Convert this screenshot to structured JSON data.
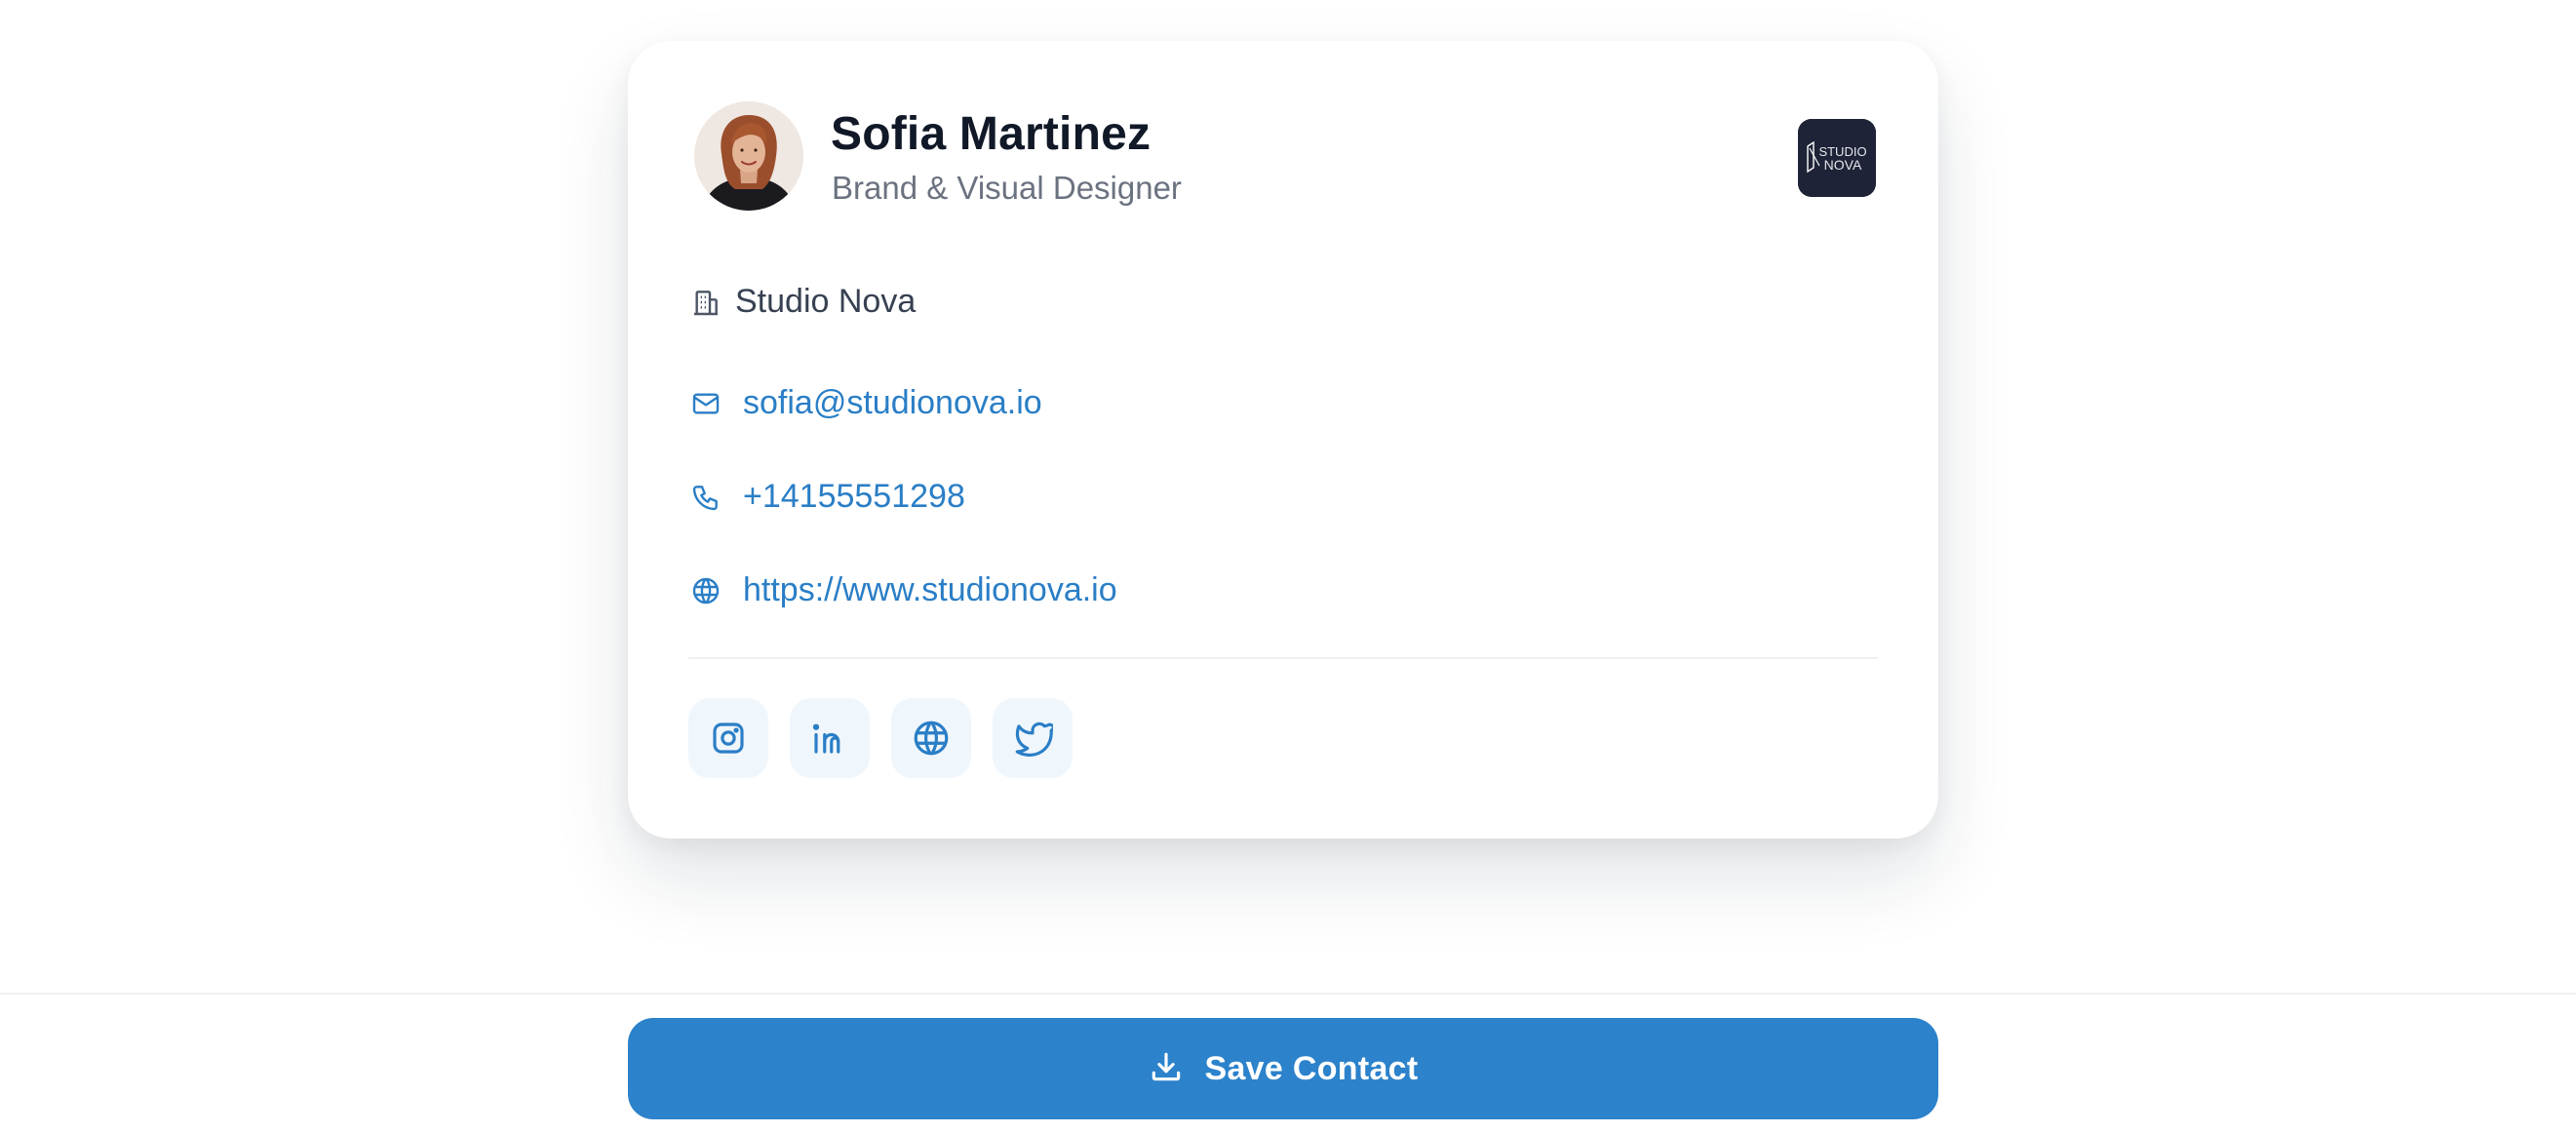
{
  "profile": {
    "name": "Sofia Martinez",
    "title": "Brand & Visual Designer",
    "company": "Studio Nova"
  },
  "logo": {
    "line1": "STUDIO",
    "line2": "NOVA",
    "bg_color": "#1f2337"
  },
  "contact": {
    "email": "sofia@studionova.io",
    "phone": "+14155551298",
    "website": "https://www.studionova.io"
  },
  "socials": [
    {
      "icon": "instagram-icon"
    },
    {
      "icon": "linkedin-icon"
    },
    {
      "icon": "globe-icon"
    },
    {
      "icon": "twitter-icon"
    }
  ],
  "footer": {
    "save_label": "Save Contact"
  },
  "colors": {
    "accent": "#2c82cb",
    "link": "#2a7ec6",
    "heading": "#111827",
    "muted": "#6b7280"
  }
}
